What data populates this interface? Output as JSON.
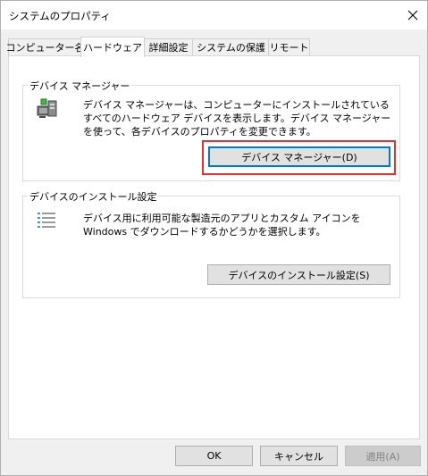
{
  "window": {
    "title": "システムのプロパティ"
  },
  "tabs": [
    {
      "label": "コンピューター名",
      "active": false
    },
    {
      "label": "ハードウェア",
      "active": true
    },
    {
      "label": "詳細設定",
      "active": false
    },
    {
      "label": "システムの保護",
      "active": false
    },
    {
      "label": "リモート",
      "active": false
    }
  ],
  "device_manager": {
    "title": "デバイス マネージャー",
    "description": "デバイス マネージャーは、コンピューターにインストールされているすべてのハードウェア デバイスを表示します。デバイス マネージャーを使って、各デバイスのプロパティを変更できます。",
    "button_label": "デバイス マネージャー(D)"
  },
  "install_settings": {
    "title": "デバイスのインストール設定",
    "description": "デバイス用に利用可能な製造元のアプリとカスタム アイコンを Windows でダウンロードするかどうかを選択します。",
    "button_label": "デバイスのインストール設定(S)"
  },
  "footer": {
    "ok_label": "OK",
    "cancel_label": "キャンセル",
    "apply_label": "適用(A)"
  },
  "colors": {
    "highlight": "#e8312f",
    "focus": "#0078d7"
  }
}
